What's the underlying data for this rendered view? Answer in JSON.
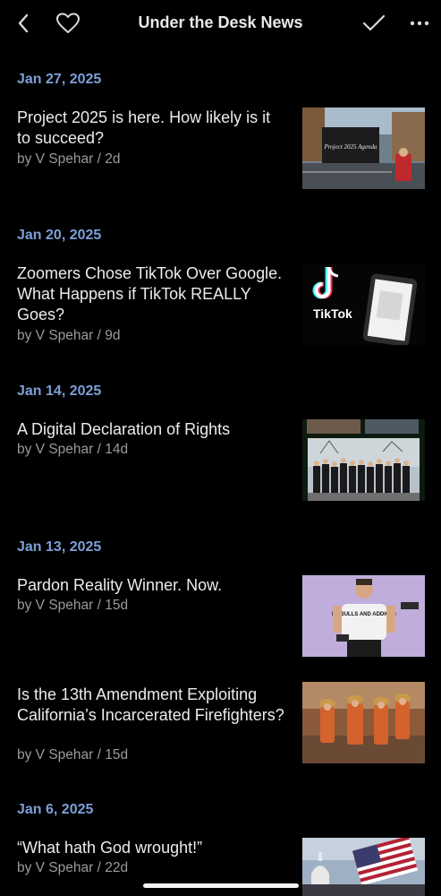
{
  "header": {
    "title": "Under the Desk News",
    "back_icon": "chevron-left-icon",
    "favorite_icon": "heart-icon",
    "done_icon": "checkmark-icon",
    "more_icon": "ellipsis-icon"
  },
  "dates": [
    "Jan 27, 2025",
    "Jan 20, 2025",
    "Jan 14, 2025",
    "Jan 13, 2025",
    "Jan 6, 2025"
  ],
  "articles": [
    {
      "title": "Project 2025 is here. How likely is it to succeed?",
      "byline": "by V Spehar / 2d",
      "thumb_sign": "Project 2025 Agenda"
    },
    {
      "title": "Zoomers Chose TikTok Over Google. What Happens if TikTok REALLY Goes?",
      "byline": "by V Spehar / 9d",
      "thumb_logo": "TikTok"
    },
    {
      "title": "A Digital Declaration of Rights",
      "byline": "by V Spehar / 14d"
    },
    {
      "title": "Pardon Reality Winner. Now.",
      "byline": "by V Spehar / 15d",
      "thumb_shirt": "PITBULLS AND ADDICTS"
    },
    {
      "title": "Is the 13th Amendment Exploiting California’s Incarcerated Firefighters?",
      "byline": "by V Spehar / 15d"
    },
    {
      "title": "“What hath God wrought!”",
      "byline": "by V Spehar / 22d"
    }
  ],
  "colors": {
    "background": "#000000",
    "date_accent": "#7c9fd6",
    "byline": "#9a9a9a"
  }
}
